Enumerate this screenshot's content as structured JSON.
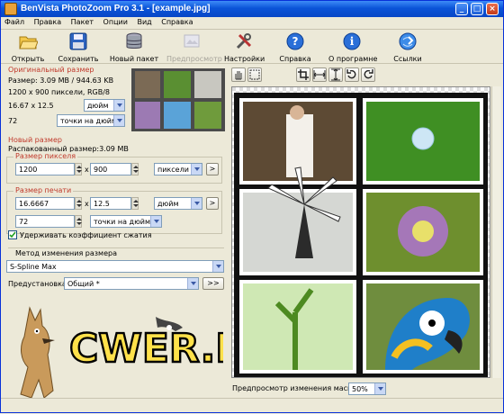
{
  "window": {
    "title": "BenVista PhotoZoom Pro 3.1 - [example.jpg]"
  },
  "menu": [
    "Файл",
    "Правка",
    "Пакет",
    "Опции",
    "Вид",
    "Справка"
  ],
  "toolbar": {
    "open": "Открыть",
    "save": "Сохранить",
    "batch": "Новый пакет",
    "preview": "Предпросмотр",
    "settings": "Настройки",
    "help": "Справка",
    "about": "О програмне",
    "links": "Ссылки"
  },
  "original": {
    "header": "Оригинальный размер",
    "size_line": "Размер: 3.09 MB / 944.63 KB",
    "pixels_line": "1200 x 900 пиксели, RGB/8",
    "dims": "16.67 x 12.5",
    "dims_unit": "дюйм",
    "dpi": "72",
    "dpi_unit": "точки на дюйм"
  },
  "newsize": {
    "header": "Новый размер",
    "unpacked": "Распакованный размер:3.09 MB",
    "pixel_header": "Размер пикселя",
    "px_w": "1200",
    "px_h": "900",
    "px_unit": "пиксели",
    "print_header": "Размер печати",
    "pr_w": "16.6667",
    "pr_h": "12.5",
    "pr_unit": "дюйм",
    "res": "72",
    "res_unit": "точки на дюйм",
    "keep_ratio": "Удерживать коэффициент сжатия",
    "x_sign": "x"
  },
  "method": {
    "header": "Метод изменения размера",
    "value": "S-Spline Max",
    "preset_label": "Предустановка:",
    "preset_value": "Общий *",
    "more": ">>"
  },
  "viewer": {
    "zoom_label": "Предпросмотр изменения масштаба:",
    "zoom_value": "50%"
  },
  "watermark": {
    "text": "CWER.RU"
  },
  "icons": {
    "open": "folder-open-icon",
    "save": "floppy-disk-icon",
    "batch": "database-icon",
    "preview": "preview-icon",
    "settings": "tools-icon",
    "help": "help-icon",
    "about": "info-icon",
    "links": "globe-link-icon"
  },
  "colors": {
    "titlebar": "#0a54d8",
    "section_header": "#c0392b",
    "background": "#ece9d8"
  }
}
